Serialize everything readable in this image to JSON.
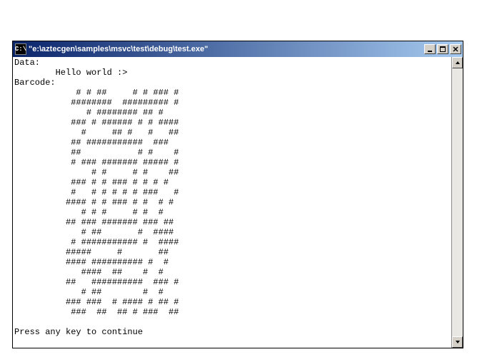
{
  "window": {
    "icon_label": "C:\\",
    "title": "\"e:\\aztecgen\\samples\\msvc\\test\\debug\\test.exe\""
  },
  "console": {
    "data_label": "Data:",
    "data_value": "        Hello world :>",
    "barcode_label": "Barcode:",
    "barcode_rows": [
      "    # # ##     # # ### #",
      "   ########  ######### #",
      "      # ######## ## #   ",
      "   ### # ###### # # ####",
      "     #     ## #   #   ##",
      "   ## ###########  ###  ",
      "   ##           # #    #",
      "   # ### ####### ##### #",
      "       # #     # #    ##",
      "   ### # # ### # # # #  ",
      "   #   # # # # # ###   #",
      "  #### # # ### # #  # # ",
      "     # # #     # #  #   ",
      "  ## ### ####### ### ## ",
      "     # ##       #  #### ",
      "   # ########### #  ####",
      "  #####     #       ##  ",
      "  #### ########## #  #  ",
      "     ####  ##    #  #   ",
      "  ##   ##########  ### #",
      "     # ##        #  #   ",
      "  ### ###  # #### # ## #",
      "   ###  ##  ## # ###  ##"
    ],
    "prompt": "Press any key to continue"
  }
}
